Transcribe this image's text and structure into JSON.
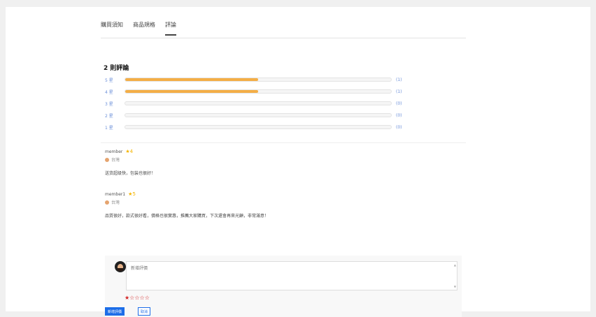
{
  "tabs": [
    "購買須知",
    "商品規格",
    "評論"
  ],
  "summary": {
    "title": "2 則評論"
  },
  "rating_rows": [
    {
      "label": "5 星",
      "fraction": 0.5,
      "count": "(1)"
    },
    {
      "label": "4 星",
      "fraction": 0.5,
      "count": "(1)"
    },
    {
      "label": "3 星",
      "fraction": 0,
      "count": "(0)"
    },
    {
      "label": "2 星",
      "fraction": 0,
      "count": "(0)"
    },
    {
      "label": "1 星",
      "fraction": 0,
      "count": "(0)"
    }
  ],
  "reviews": [
    {
      "name": "member",
      "stars": "★4",
      "time": "台灣",
      "text": "送货超级快，包装也很好！"
    },
    {
      "name": "member1",
      "stars": "★5",
      "time": "台灣",
      "text": "品質很好，款式很好看，價格也很實惠，推薦大家購買，下次還會再來光顧，非常滿意！"
    }
  ],
  "comment": {
    "placeholder": "新增評價",
    "stars": "★☆☆☆☆",
    "post_label": "新增評價",
    "cancel_label": "取消"
  },
  "colors": {
    "bar_fill": "#f4ae46",
    "primary": "#1c6de8",
    "star_input": "#d32222"
  }
}
